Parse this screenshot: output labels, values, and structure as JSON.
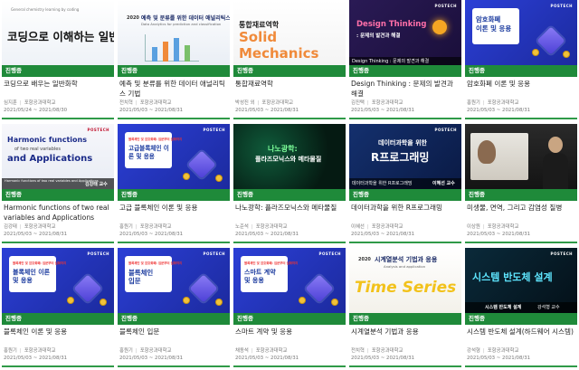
{
  "badge_label": "진행중",
  "separator": "|",
  "row1": [
    {
      "title": "코딩으로 배우는 일반화학",
      "instructor": "심지훈",
      "school": "포항공과대학교",
      "dates": "2021/05/24 ~ 2021/08/30",
      "thumb_text": "코딩으로 이해하는 일반화학",
      "thumb_caption": "General chemistry learning by coding"
    },
    {
      "title": "예측 및 분류를 위한 데이터 애널리틱스 기법",
      "instructor": "전치혁",
      "school": "포항공과대학교",
      "dates": "2021/05/03 ~ 2021/08/31",
      "thumb_year": "2020",
      "thumb_text": "예측 및 분류를 위한 데이터 애널리틱스 기법",
      "thumb_caption": "Data Analytics for prediction and classification"
    },
    {
      "title": "통합재료역학",
      "instructor": "박성진 외",
      "school": "포항공과대학교",
      "dates": "2021/05/03 ~ 2021/08/31",
      "thumb_text1": "통합재료역학",
      "thumb_text2": "Solid",
      "thumb_text3": "Mechanics"
    },
    {
      "title": "Design Thinking : 문제의 발견과 해결",
      "instructor": "김진택",
      "school": "포항공과대학교",
      "dates": "2021/05/03 ~ 2021/08/31",
      "thumb_text": "Design Thinking",
      "thumb_sub": ": 문제의 발견과 해결",
      "thumb_bar": "Design Thinking : 문제의 발견과 해결",
      "thumb_prof": "김진택 교수"
    },
    {
      "title": "암호화폐 이론 및 응용",
      "instructor": "홍원기",
      "school": "포항공과대학교",
      "dates": "2021/05/03 ~ 2021/08/31",
      "thumb_line1": "암호화폐",
      "thumb_line2": "이론 및 응용"
    }
  ],
  "row2": [
    {
      "title": "Harmonic functions of two real variables and Applications",
      "instructor": "김강태",
      "school": "포항공과대학교",
      "dates": "2021/05/03 ~ 2021/08/31",
      "thumb_line1": "Harmonic functions",
      "thumb_line2": "of two real variables",
      "thumb_line3": "and Applications",
      "thumb_bar": "Harmonic functions of two real variables and Applications",
      "thumb_prof": "김강태 교수"
    },
    {
      "title": "고급 블록체인 이론 및 응용",
      "instructor": "홍원기",
      "school": "포항공과대학교",
      "dates": "2021/05/03 ~ 2021/08/31",
      "thumb_small": "블록체인 및 암호화폐: 입문부터 심화까지",
      "thumb_big": "고급블록체인 이론 및 응용"
    },
    {
      "title": "나노광학: 플라즈모닉스와 메타물질",
      "instructor": "노준석",
      "school": "포항공과대학교",
      "dates": "2021/05/03 ~ 2021/08/31",
      "thumb_line1": "나노광학:",
      "thumb_line2": "플라즈모닉스와 메타물질"
    },
    {
      "title": "데이터과학을 위한 R프로그래밍",
      "instructor": "이혜선",
      "school": "포항공과대학교",
      "dates": "2021/05/03 ~ 2021/08/31",
      "thumb_line1": "데이터과학을 위한",
      "thumb_line2": "R프로그래밍",
      "thumb_bar": "데이터과학을 위한 R프로그래밍",
      "thumb_prof": "이혜선 교수"
    },
    {
      "title": "미생물, 면역, 그리고 감염성 질병",
      "instructor": "이상원",
      "school": "포항공과대학교",
      "dates": "2021/05/03 ~ 2021/08/31"
    }
  ],
  "row3": [
    {
      "title": "블록체인 이론 및 응용",
      "instructor": "홍원기",
      "school": "포항공과대학교",
      "dates": "2021/05/03 ~ 2021/08/31",
      "thumb_small": "블록체인 및 암호화폐: 입문부터 심화까지",
      "thumb_big": "블록체인 이론 및 응용"
    },
    {
      "title": "블록체인 입문",
      "instructor": "홍원기",
      "school": "포항공과대학교",
      "dates": "2021/05/03 ~ 2021/08/31",
      "thumb_small": "블록체인 및 암호화폐: 입문부터 심화까지",
      "thumb_big": "블록체인 입문"
    },
    {
      "title": "스마트 계약 및 응용",
      "instructor": "채동석",
      "school": "포항공과대학교",
      "dates": "2021/05/03 ~ 2021/08/31",
      "thumb_small": "블록체인 및 암호화폐: 입문부터 심화까지",
      "thumb_big": "스마트 계약 및 응용"
    },
    {
      "title": "시계열분석 기법과 응용",
      "instructor": "전치혁",
      "school": "포항공과대학교",
      "dates": "2021/05/03 ~ 2021/08/31",
      "thumb_year": "2020",
      "thumb_text": "시계열분석 기법과 응용",
      "thumb_caption": "Analysis and application",
      "thumb_big": "Time Series"
    },
    {
      "title": "시스템 반도체 설계(하드웨어 시스템)",
      "instructor": "강석형",
      "school": "포항공과대학교",
      "dates": "2021/05/03 ~ 2021/08/31",
      "thumb_big": "시스템 반도체 설계",
      "thumb_bar": "시스템 반도체 설계",
      "thumb_prof": "강석형 교수"
    }
  ],
  "logo_text": "POSTECH",
  "colors": {
    "badge": "#1f8a3a",
    "underline": "#2f9a48"
  }
}
